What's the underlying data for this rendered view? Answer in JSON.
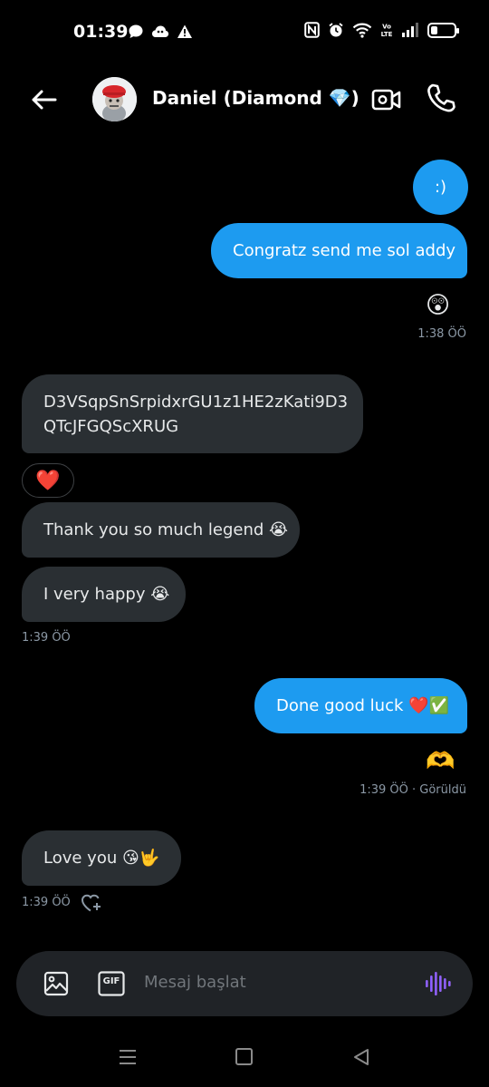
{
  "status_bar": {
    "time": "01:39",
    "left_icons": [
      "chat-bubble-icon",
      "cloud-icon",
      "warning-icon"
    ],
    "right_icons": [
      "nfc-icon",
      "alarm-icon",
      "wifi-icon",
      "volte-icon",
      "signal-icon",
      "battery-icon"
    ],
    "volte_label": "Vo\nLTE",
    "battery_level": 0.3
  },
  "header": {
    "contact_name": "Daniel (Diamond 💎)"
  },
  "messages": [
    {
      "direction": "outgoing",
      "text": ":)"
    },
    {
      "direction": "outgoing",
      "text": "Congratz send me sol addy"
    },
    {
      "direction": "incoming",
      "text": "D3VSqpSnSrpidxrGU1z1HE2zKati9D3\nQTcJFGQScXRUG"
    },
    {
      "direction": "incoming",
      "text": "Thank you so much legend 😭"
    },
    {
      "direction": "incoming",
      "text": "I very happy 😭"
    },
    {
      "direction": "outgoing",
      "text": "Done good luck ❤️✅"
    },
    {
      "direction": "incoming",
      "text": "Love you 😘🤟"
    }
  ],
  "reactions": {
    "first_outgoing": "😲",
    "address_message": "❤️",
    "done_message": "🫶"
  },
  "timestamps": {
    "first_outgoing": "1:38 ÖÖ",
    "incoming_group": "1:39 ÖÖ",
    "done_message": "1:39 ÖÖ · Görüldü",
    "last_message": "1:39 ÖÖ"
  },
  "composer": {
    "placeholder": "Mesaj başlat",
    "gif_label": "GIF"
  }
}
